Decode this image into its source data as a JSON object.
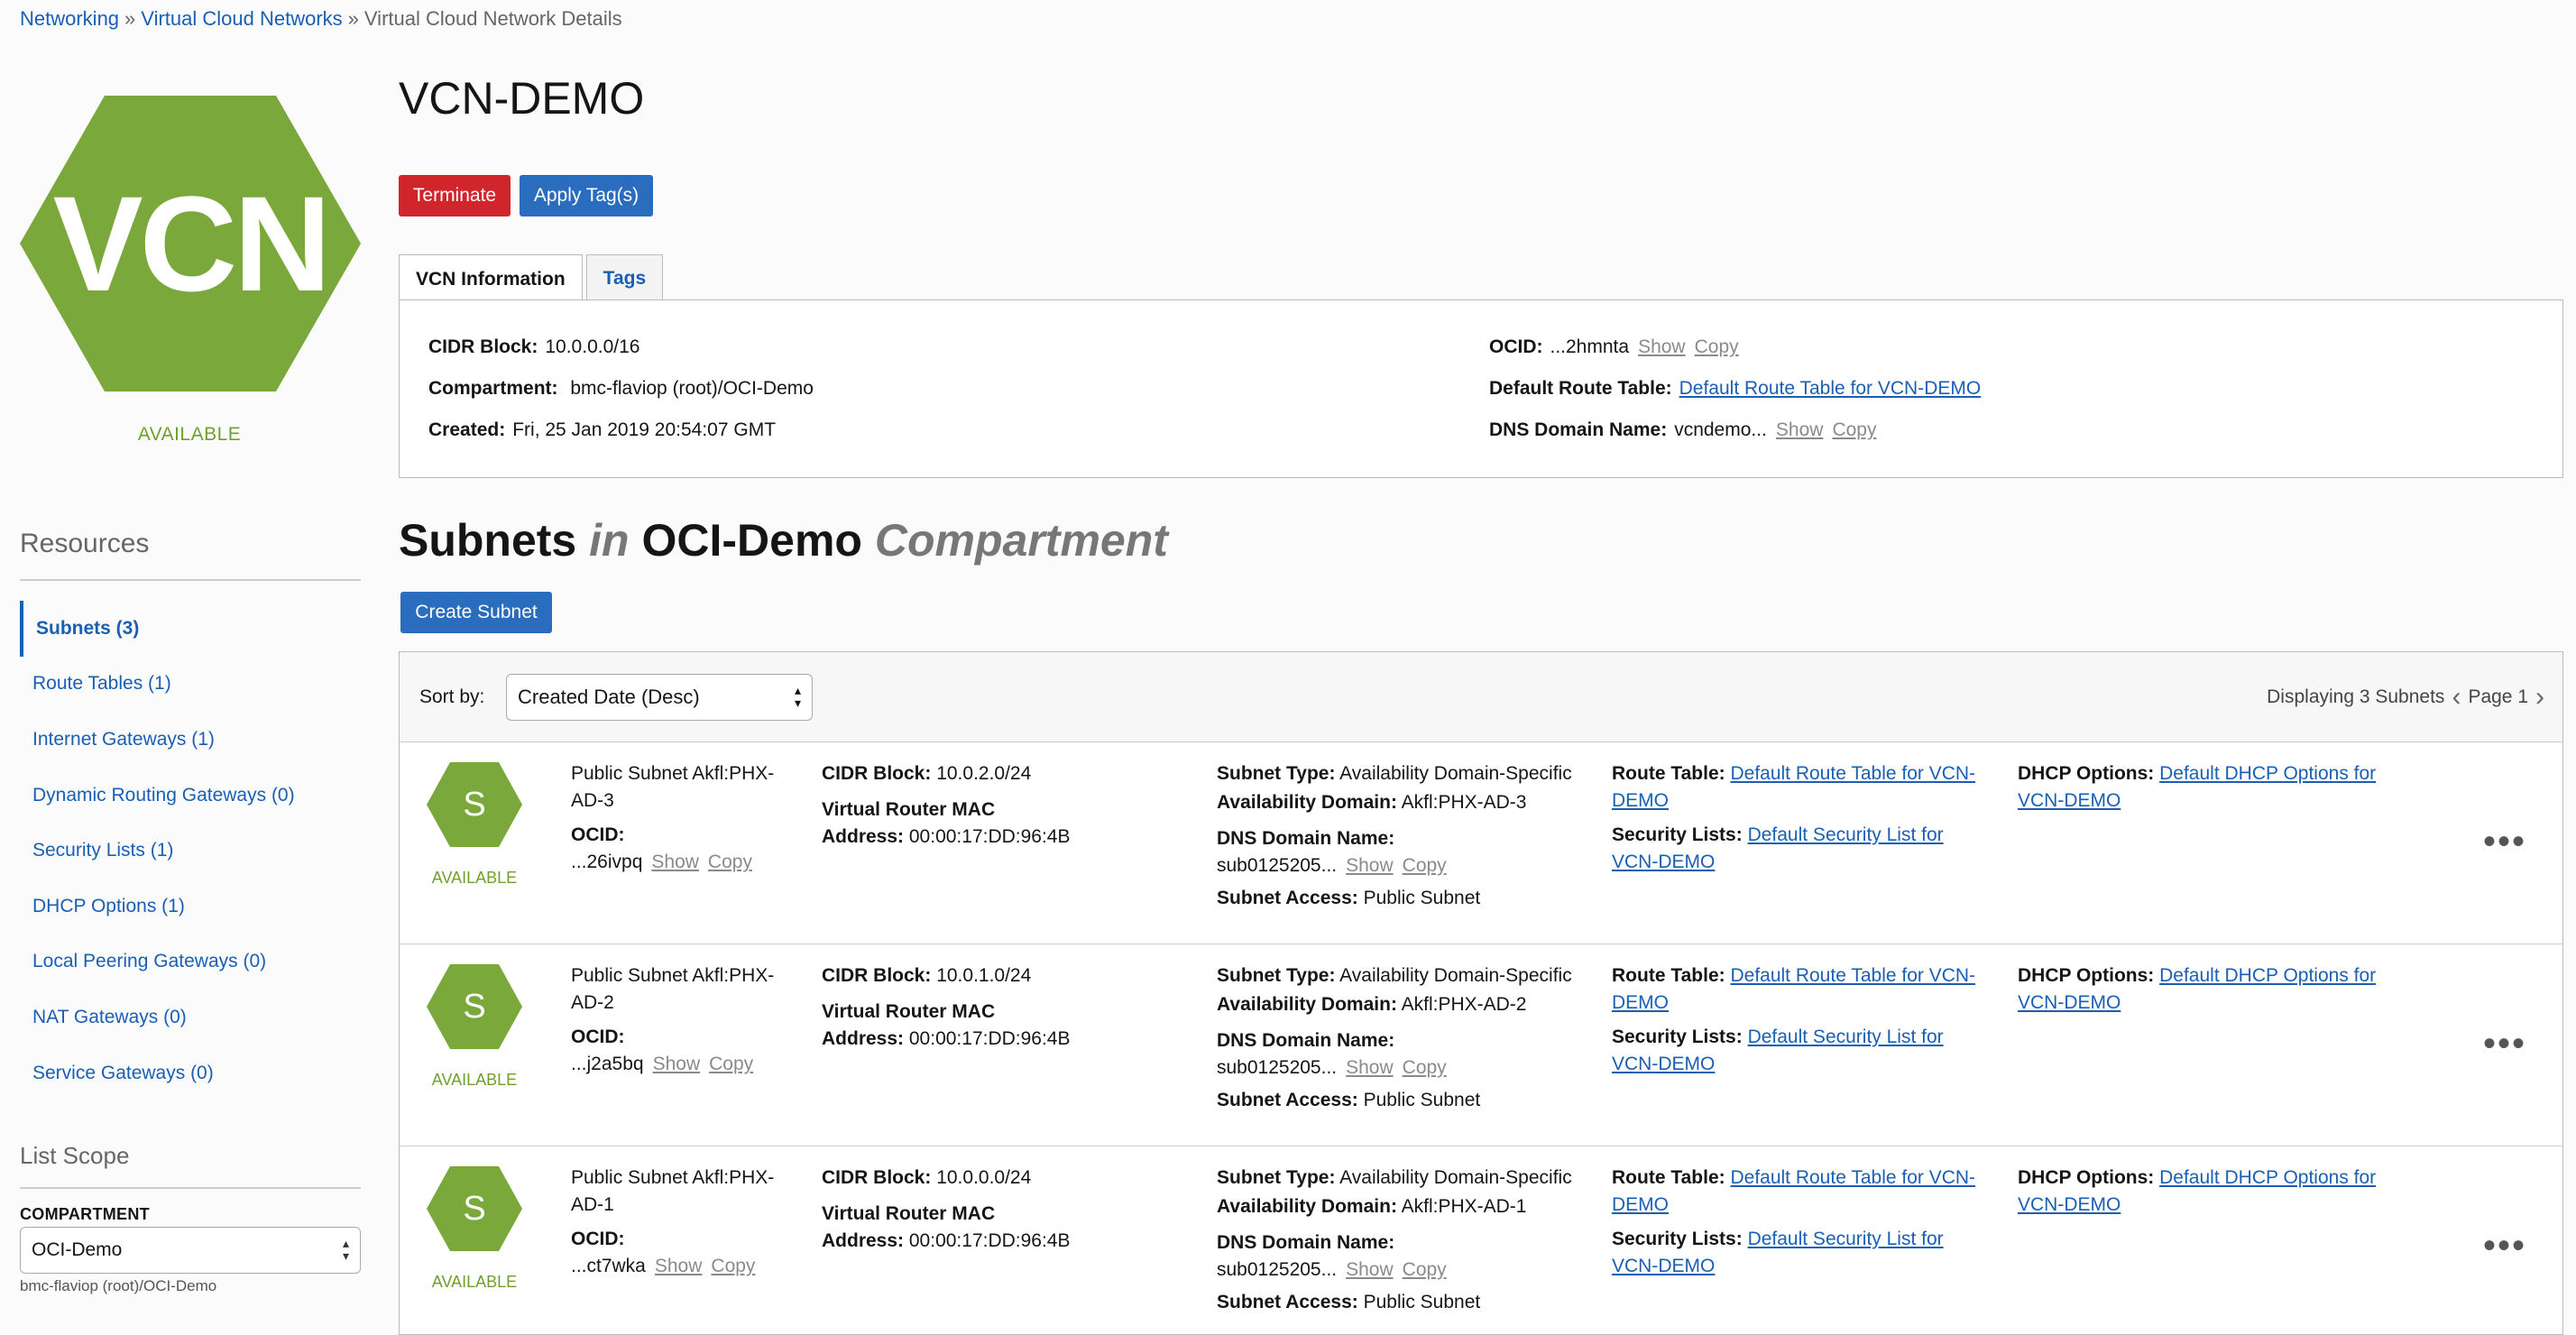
{
  "breadcrumb": {
    "items": [
      "Networking",
      "Virtual Cloud Networks",
      "Virtual Cloud Network Details"
    ],
    "separator": "»"
  },
  "vcn": {
    "icon_text": "VCN",
    "status": "AVAILABLE",
    "title": "VCN-DEMO"
  },
  "actions": {
    "terminate": "Terminate",
    "apply_tags": "Apply Tag(s)"
  },
  "tabs": [
    "VCN Information",
    "Tags"
  ],
  "info": {
    "cidr_label": "CIDR Block:",
    "cidr_value": "10.0.0.0/16",
    "compartment_label": "Compartment:",
    "compartment_value": "bmc-flaviop (root)/OCI-Demo",
    "created_label": "Created:",
    "created_value": "Fri, 25 Jan 2019 20:54:07 GMT",
    "ocid_label": "OCID:",
    "ocid_value": "...2hmnta",
    "show": "Show",
    "copy": "Copy",
    "route_label": "Default Route Table:",
    "route_value": "Default Route Table for VCN-DEMO",
    "dns_label": "DNS Domain Name:",
    "dns_value": "vcndemo..."
  },
  "resources": {
    "title": "Resources",
    "items": [
      "Subnets (3)",
      "Route Tables (1)",
      "Internet Gateways (1)",
      "Dynamic Routing Gateways (0)",
      "Security Lists (1)",
      "DHCP Options (1)",
      "Local Peering Gateways (0)",
      "NAT Gateways (0)",
      "Service Gateways (0)"
    ]
  },
  "scope": {
    "title": "List Scope",
    "compartment_label": "COMPARTMENT",
    "compartment_value": "OCI-Demo",
    "compartment_path": "bmc-flaviop (root)/OCI-Demo"
  },
  "subnets": {
    "title_main": "Subnets",
    "title_in": "in",
    "title_comp": "OCI-Demo",
    "title_suffix": "Compartment",
    "create_button": "Create Subnet",
    "sort_label": "Sort by:",
    "sort_value": "Created Date (Desc)",
    "displaying": "Displaying 3 Subnets",
    "page": "Page 1",
    "labels": {
      "ocid": "OCID:",
      "cidr": "CIDR Block:",
      "vr_mac": "Virtual Router MAC",
      "address": "Address:",
      "subnet_type": "Subnet Type:",
      "ad": "Availability Domain:",
      "dns": "DNS Domain Name:",
      "access": "Subnet Access:",
      "route": "Route Table:",
      "security": "Security Lists:",
      "dhcp": "DHCP Options:",
      "show": "Show",
      "copy": "Copy"
    },
    "rows": [
      {
        "icon": "S",
        "status": "AVAILABLE",
        "name_1": "Public Subnet Akfl:PHX-",
        "name_2": "AD-3",
        "ocid": "...26ivpq",
        "cidr": "10.0.2.0/24",
        "mac": "00:00:17:DD:96:4B",
        "type": "Availability Domain-Specific",
        "ad": "Akfl:PHX-AD-3",
        "dns": "sub0125205...",
        "access": "Public Subnet",
        "route_1": "Default Route Table for VCN-",
        "route_2": "DEMO",
        "security_1": "Default Security List for",
        "security_2": "VCN-DEMO",
        "dhcp_1": "Default DHCP Options for",
        "dhcp_2": "VCN-DEMO"
      },
      {
        "icon": "S",
        "status": "AVAILABLE",
        "name_1": "Public Subnet Akfl:PHX-",
        "name_2": "AD-2",
        "ocid": "...j2a5bq",
        "cidr": "10.0.1.0/24",
        "mac": "00:00:17:DD:96:4B",
        "type": "Availability Domain-Specific",
        "ad": "Akfl:PHX-AD-2",
        "dns": "sub0125205...",
        "access": "Public Subnet",
        "route_1": "Default Route Table for VCN-",
        "route_2": "DEMO",
        "security_1": "Default Security List for",
        "security_2": "VCN-DEMO",
        "dhcp_1": "Default DHCP Options for",
        "dhcp_2": "VCN-DEMO"
      },
      {
        "icon": "S",
        "status": "AVAILABLE",
        "name_1": "Public Subnet Akfl:PHX-",
        "name_2": "AD-1",
        "ocid": "...ct7wka",
        "cidr": "10.0.0.0/24",
        "mac": "00:00:17:DD:96:4B",
        "type": "Availability Domain-Specific",
        "ad": "Akfl:PHX-AD-1",
        "dns": "sub0125205...",
        "access": "Public Subnet",
        "route_1": "Default Route Table for VCN-",
        "route_2": "DEMO",
        "security_1": "Default Security List for",
        "security_2": "VCN-DEMO",
        "dhcp_1": "Default DHCP Options for",
        "dhcp_2": "VCN-DEMO"
      }
    ]
  },
  "colors": {
    "brand_green": "#7aa83a",
    "status_green": "#6fa02e",
    "link_blue": "#1a5fb4",
    "danger_red": "#d0252b",
    "primary_blue": "#2a6dbf"
  }
}
